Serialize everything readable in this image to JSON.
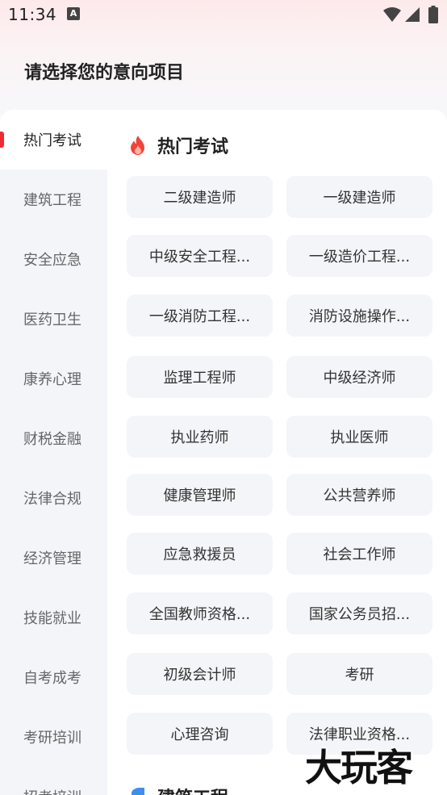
{
  "status_bar": {
    "time": "11:34",
    "notification_icon": "A",
    "icons": [
      "wifi-icon",
      "signal-icon",
      "battery-icon"
    ]
  },
  "page": {
    "title": "请选择您的意向项目"
  },
  "sidebar": {
    "items": [
      {
        "label": "热门考试",
        "active": true
      },
      {
        "label": "建筑工程",
        "active": false
      },
      {
        "label": "安全应急",
        "active": false
      },
      {
        "label": "医药卫生",
        "active": false
      },
      {
        "label": "康养心理",
        "active": false
      },
      {
        "label": "财税金融",
        "active": false
      },
      {
        "label": "法律合规",
        "active": false
      },
      {
        "label": "经济管理",
        "active": false
      },
      {
        "label": "技能就业",
        "active": false
      },
      {
        "label": "自考成考",
        "active": false
      },
      {
        "label": "考研培训",
        "active": false
      },
      {
        "label": "招考培训",
        "active": false
      }
    ]
  },
  "sections": [
    {
      "icon": "flame-icon",
      "title": "热门考试",
      "tags": [
        "二级建造师",
        "一级建造师",
        "中级安全工程...",
        "一级造价工程...",
        "一级消防工程...",
        "消防设施操作...",
        "监理工程师",
        "中级经济师",
        "执业药师",
        "执业医师",
        "健康管理师",
        "公共营养师",
        "应急救援员",
        "社会工作师",
        "全国教师资格...",
        "国家公务员招...",
        "初级会计师",
        "考研",
        "心理咨询",
        "法律职业资格..."
      ]
    },
    {
      "icon": "building-icon",
      "title": "建筑工程"
    }
  ],
  "watermark": "大玩客",
  "colors": {
    "accent": "#ee2a35",
    "tag_bg": "#f4f5f8",
    "sidebar_bg": "#f4f5f9"
  }
}
